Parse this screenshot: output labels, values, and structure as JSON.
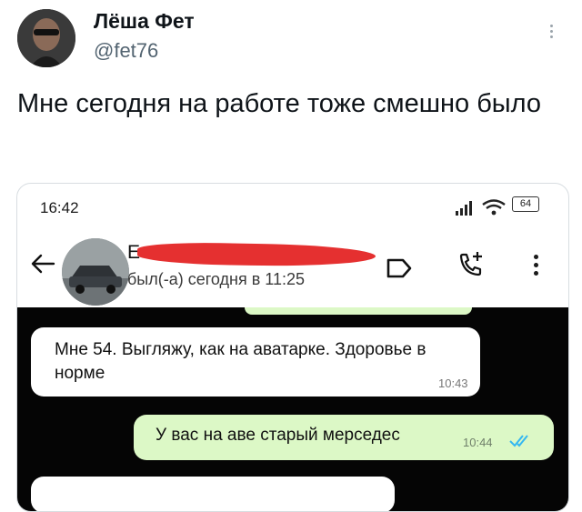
{
  "tweet": {
    "author_name": "Лёша Фет",
    "author_handle": "@fet76",
    "text": "Мне сегодня на работе тоже смешно было",
    "more_icon": "vertical-dots-icon"
  },
  "screenshot": {
    "status_bar": {
      "time": "16:42",
      "battery": "64",
      "icons": [
        "signal-icon",
        "wifi-icon",
        "battery-icon"
      ]
    },
    "chat_header": {
      "contact_name_visible": "Е",
      "contact_status": "был(-а) сегодня в 11:25",
      "icons": [
        "back-arrow-icon",
        "video-call-icon",
        "add-call-icon",
        "menu-dots-icon"
      ]
    },
    "messages": [
      {
        "direction": "incoming",
        "text": "Мне 54. Выгляжу, как на аватарке. Здоровье в норме",
        "time": "10:43"
      },
      {
        "direction": "outgoing",
        "text": "У вас на аве старый мерседес",
        "time": "10:44",
        "status": "read"
      }
    ],
    "colors": {
      "chat_background": "#050505",
      "outgoing_bubble": "#dcf8c6",
      "incoming_bubble": "#ffffff",
      "redaction": "#e53030",
      "read_ticks": "#34b7f1"
    }
  }
}
